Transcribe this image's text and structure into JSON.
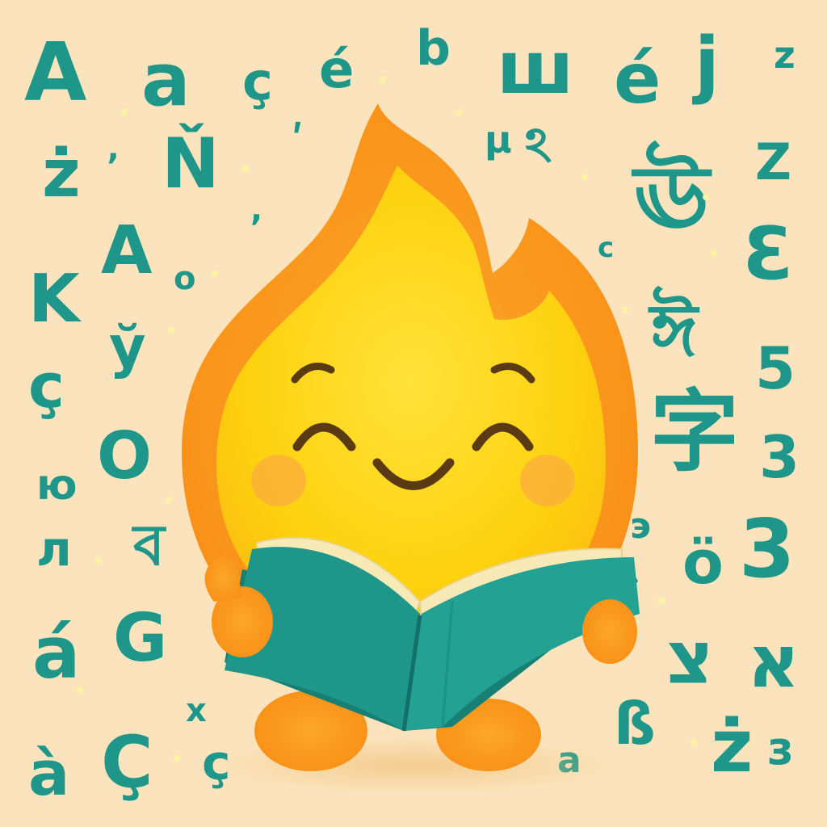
{
  "palette": {
    "background": "#fbe4bd",
    "letters": "#1e978a",
    "flame_outer": "#fb9b1a",
    "flame_inner": "#fdd20f",
    "cheeks": "#fbb03a",
    "face_features": "#5a3a12",
    "book_cover": "#1e978a",
    "book_pages": "#f8eab6"
  },
  "mascot": {
    "subject": "flame-mascot",
    "expression": "smiling",
    "holding": "open-book"
  },
  "letters": [
    "A",
    "a",
    "ç",
    "é",
    "b",
    "ш",
    "é",
    "j",
    "z",
    "ż",
    "’",
    "Ň",
    ",",
    "ʹ",
    "µ",
    "ঽ",
    "Z",
    "A",
    "o",
    "c",
    "ঊ",
    "Ɛ",
    "K",
    "ў",
    "ঈ",
    "5",
    "ç",
    "字",
    "3",
    "ю",
    "O",
    "э",
    "л",
    "ব",
    "ö",
    "3",
    "á",
    "G",
    "צ",
    "א",
    "à",
    "Ç",
    "x",
    "ç",
    "a",
    "ß",
    "ż",
    "з"
  ]
}
